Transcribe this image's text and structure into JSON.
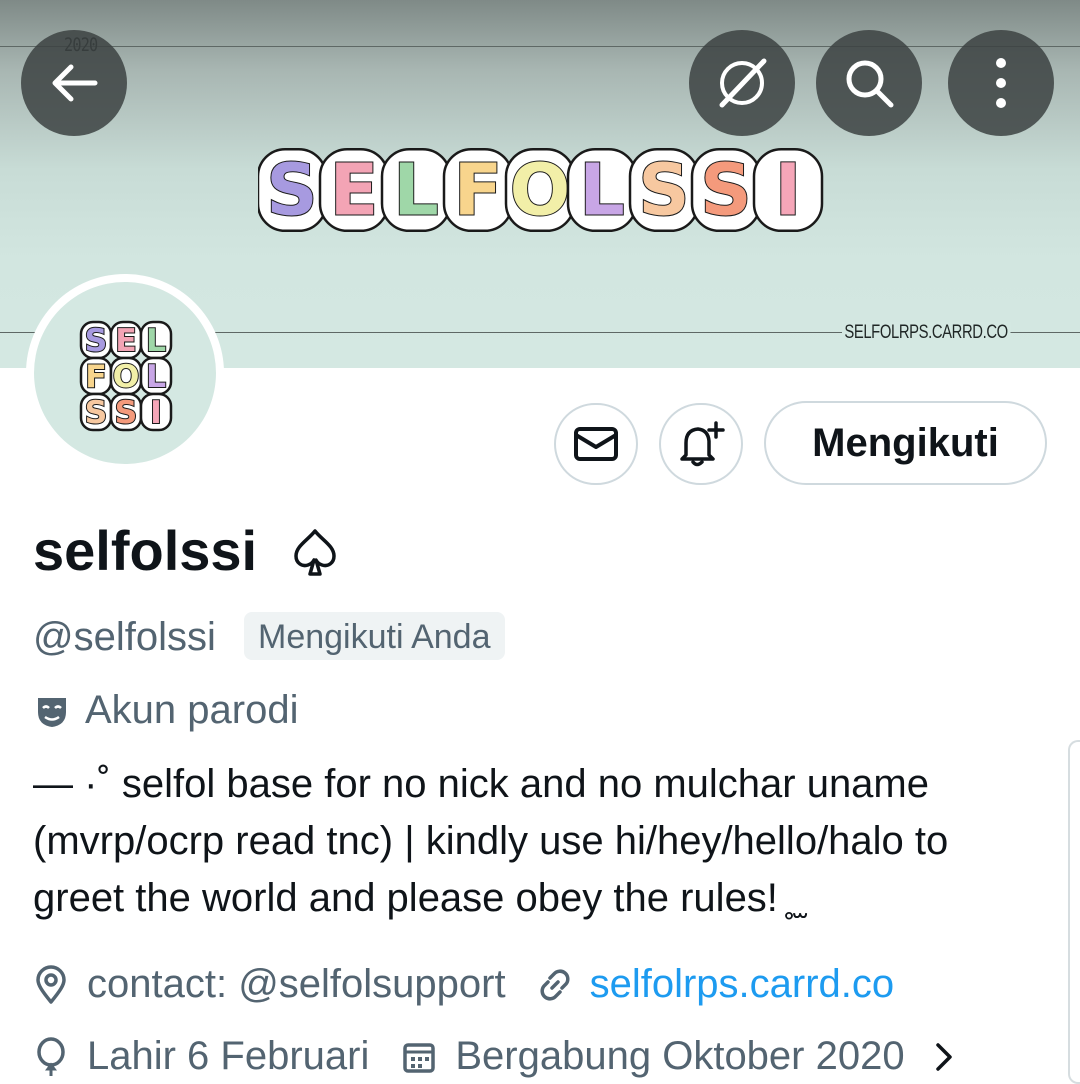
{
  "banner": {
    "year_text": "2020",
    "logo_letters": [
      "S",
      "E",
      "L",
      "F",
      "O",
      "L",
      "S",
      "S",
      "I"
    ],
    "url_text": "SELFOLRPS.CARRD.CO",
    "colors": [
      "#a79ae0",
      "#f3a4b5",
      "#9fd7a8",
      "#f8d58d",
      "#f2efa8",
      "#c8a6e6",
      "#f7c8a0",
      "#f49a7c",
      "#f5a6b8"
    ]
  },
  "header_buttons": {
    "back_icon": "arrow-left-icon",
    "grok_icon": "slash-circle-icon",
    "search_icon": "search-icon",
    "more_icon": "more-vertical-icon"
  },
  "actions": {
    "message_icon": "envelope-icon",
    "notify_icon": "bell-plus-icon",
    "follow_label": "Mengikuti"
  },
  "profile": {
    "display_name": "selfolssi",
    "name_symbol": "♤",
    "handle": "@selfolssi",
    "follows_you": "Mengikuti Anda",
    "parody_label": "Akun parodi",
    "bio_lines": [
      "— ·˚ selfol base for no nick and no mulchar uname",
      "(mvrp/ocrp read tnc) | kindly use hi/hey/hello/halo to",
      "greet the world and please obey the rules! ̥ ̫̫ "
    ],
    "location": "contact: @selfolsupport",
    "website": "selfolrps.carrd.co",
    "birthday": "Lahir 6 Februari",
    "joined": "Bergabung Oktober 2020"
  }
}
